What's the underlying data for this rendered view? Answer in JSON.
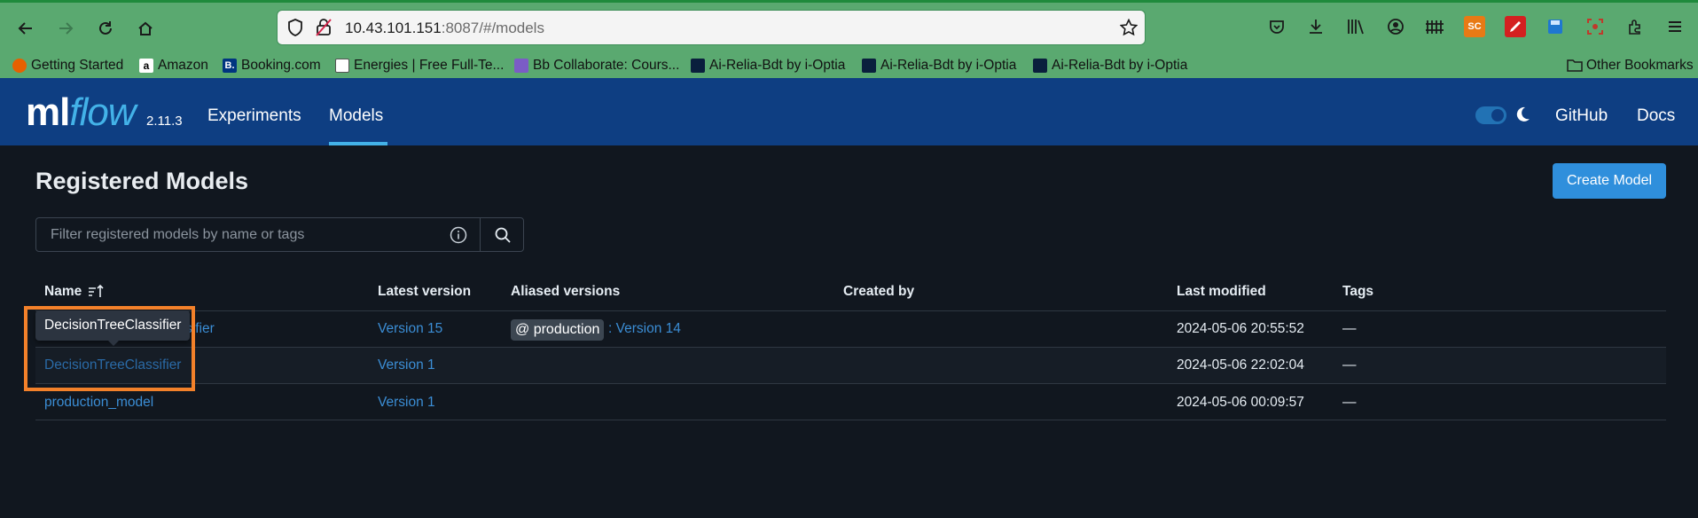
{
  "browser": {
    "url_host": "10.43.101.151",
    "url_rest": ":8087/#/models",
    "extension_badge": "SC",
    "bookmarks": [
      {
        "label": "Getting Started",
        "color": "#e66000"
      },
      {
        "label": "Amazon",
        "color": "#ffffff"
      },
      {
        "label": "Booking.com",
        "color": "#003580"
      },
      {
        "label": "Energies | Free Full-Te...",
        "color": "#ffffff"
      },
      {
        "label": "Bb Collaborate: Cours...",
        "color": "#7b5cc6"
      },
      {
        "label": "Ai-Relia-Bdt by i-Optia",
        "color": "#0a1f3d"
      },
      {
        "label": "Ai-Relia-Bdt by i-Optia",
        "color": "#0a1f3d"
      },
      {
        "label": "Ai-Relia-Bdt by i-Optia",
        "color": "#0a1f3d"
      }
    ],
    "other_bookmarks": "Other Bookmarks"
  },
  "header": {
    "logo_ml": "ml",
    "logo_flow": "flow",
    "version": "2.11.3",
    "nav": {
      "experiments": "Experiments",
      "models": "Models"
    },
    "github": "GitHub",
    "docs": "Docs"
  },
  "main": {
    "title": "Registered Models",
    "create_button": "Create Model",
    "search_placeholder": "Filter registered models by name or tags"
  },
  "table": {
    "columns": {
      "name": "Name",
      "latest_version": "Latest version",
      "aliased_versions": "Aliased versions",
      "created_by": "Created by",
      "last_modified": "Last modified",
      "tags": "Tags"
    },
    "rows": [
      {
        "name": "DecisionTreeClassifier",
        "name_visible": "sifier",
        "latest_version": "Version 15",
        "alias": "@ production",
        "alias_version": ": Version 14",
        "created_by": "",
        "last_modified": "2024-05-06 20:55:52",
        "tags": "—"
      },
      {
        "name": "DecisionTreeClassifier",
        "latest_version": "Version 1",
        "alias": "",
        "alias_version": "",
        "created_by": "",
        "last_modified": "2024-05-06 22:02:04",
        "tags": "—"
      },
      {
        "name": "production_model",
        "latest_version": "Version 1",
        "alias": "",
        "alias_version": "",
        "created_by": "",
        "last_modified": "2024-05-06 00:09:57",
        "tags": "—"
      }
    ]
  },
  "tooltip": "DecisionTreeClassifier",
  "colors": {
    "accent": "#43b2e8",
    "link": "#3b8ed6",
    "highlight": "#f3812a",
    "header": "#0e3e82",
    "chrome": "#5aa970"
  }
}
